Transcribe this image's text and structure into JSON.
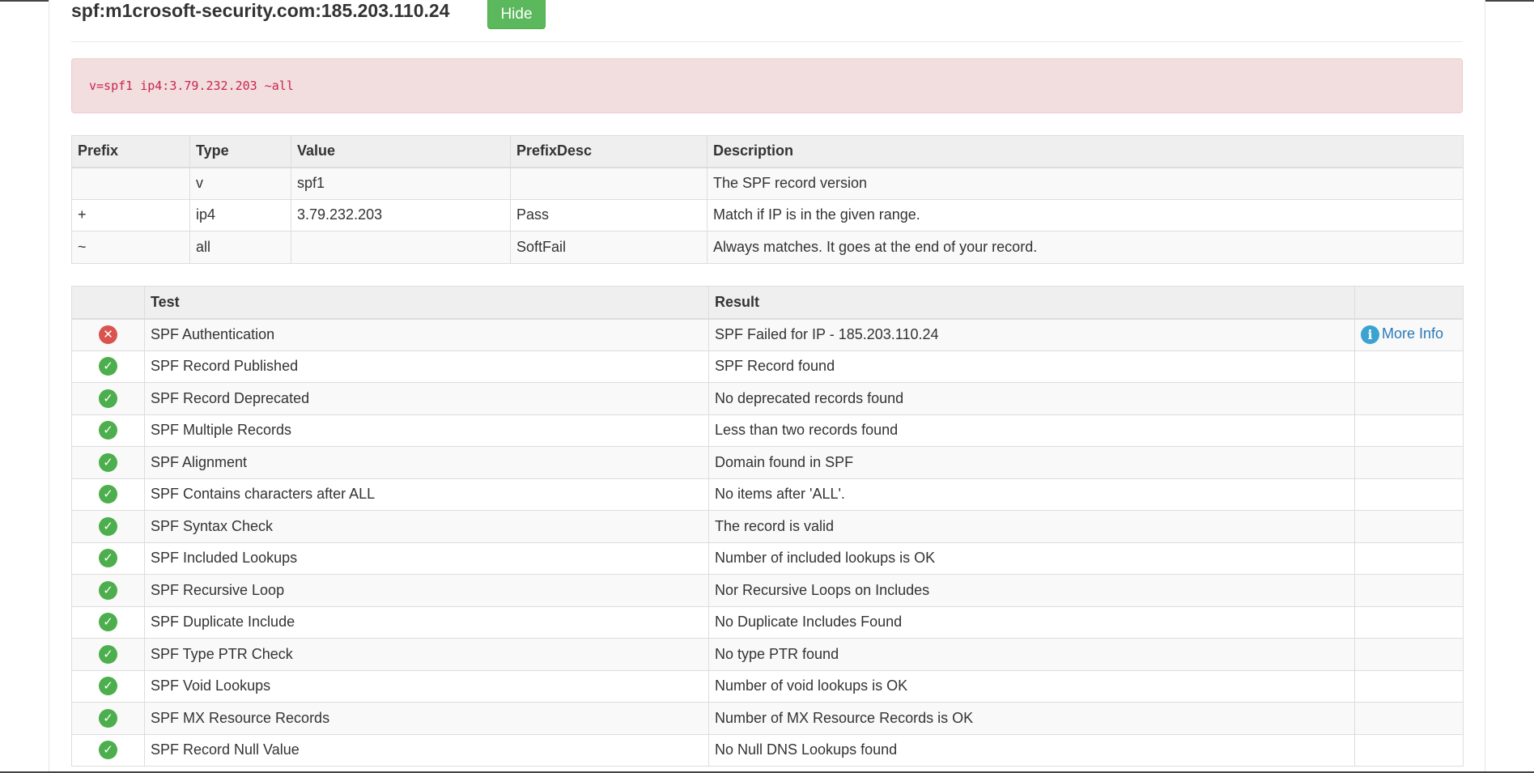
{
  "header": {
    "title": "spf:m1crosoft-security.com:185.203.110.24",
    "hide_label": "Hide"
  },
  "record": "v=spf1 ip4:3.79.232.203 ~all",
  "record_table": {
    "columns": [
      "Prefix",
      "Type",
      "Value",
      "PrefixDesc",
      "Description"
    ],
    "rows": [
      [
        "",
        "v",
        "spf1",
        "",
        "The SPF record version"
      ],
      [
        "+",
        "ip4",
        "3.79.232.203",
        "Pass",
        "Match if IP is in the given range."
      ],
      [
        "~",
        "all",
        "",
        "SoftFail",
        "Always matches. It goes at the end of your record."
      ]
    ]
  },
  "tests_table": {
    "columns": [
      "",
      "Test",
      "Result",
      ""
    ],
    "more_info_label": "More Info",
    "rows": [
      {
        "status": "fail",
        "test": "SPF Authentication",
        "result": "SPF Failed for IP - 185.203.110.24",
        "more_info": true
      },
      {
        "status": "pass",
        "test": "SPF Record Published",
        "result": "SPF Record found",
        "more_info": false
      },
      {
        "status": "pass",
        "test": "SPF Record Deprecated",
        "result": "No deprecated records found",
        "more_info": false
      },
      {
        "status": "pass",
        "test": "SPF Multiple Records",
        "result": "Less than two records found",
        "more_info": false
      },
      {
        "status": "pass",
        "test": "SPF Alignment",
        "result": "Domain found in SPF",
        "more_info": false
      },
      {
        "status": "pass",
        "test": "SPF Contains characters after ALL",
        "result": "No items after 'ALL'.",
        "more_info": false
      },
      {
        "status": "pass",
        "test": "SPF Syntax Check",
        "result": "The record is valid",
        "more_info": false
      },
      {
        "status": "pass",
        "test": "SPF Included Lookups",
        "result": "Number of included lookups is OK",
        "more_info": false
      },
      {
        "status": "pass",
        "test": "SPF Recursive Loop",
        "result": "Nor Recursive Loops on Includes",
        "more_info": false
      },
      {
        "status": "pass",
        "test": "SPF Duplicate Include",
        "result": "No Duplicate Includes Found",
        "more_info": false
      },
      {
        "status": "pass",
        "test": "SPF Type PTR Check",
        "result": "No type PTR found",
        "more_info": false
      },
      {
        "status": "pass",
        "test": "SPF Void Lookups",
        "result": "Number of void lookups is OK",
        "more_info": false
      },
      {
        "status": "pass",
        "test": "SPF MX Resource Records",
        "result": "Number of MX Resource Records is OK",
        "more_info": false
      },
      {
        "status": "pass",
        "test": "SPF Record Null Value",
        "result": "No Null DNS Lookups found",
        "more_info": false
      }
    ]
  },
  "colors": {
    "pass": "#4cae4c",
    "fail": "#d9534f",
    "alert_bg": "#f2dede",
    "button": "#5cb85c",
    "link": "#2a7ab8"
  },
  "icons": {
    "pass": "check-circle-icon",
    "fail": "x-circle-icon",
    "info": "info-circle-icon"
  }
}
